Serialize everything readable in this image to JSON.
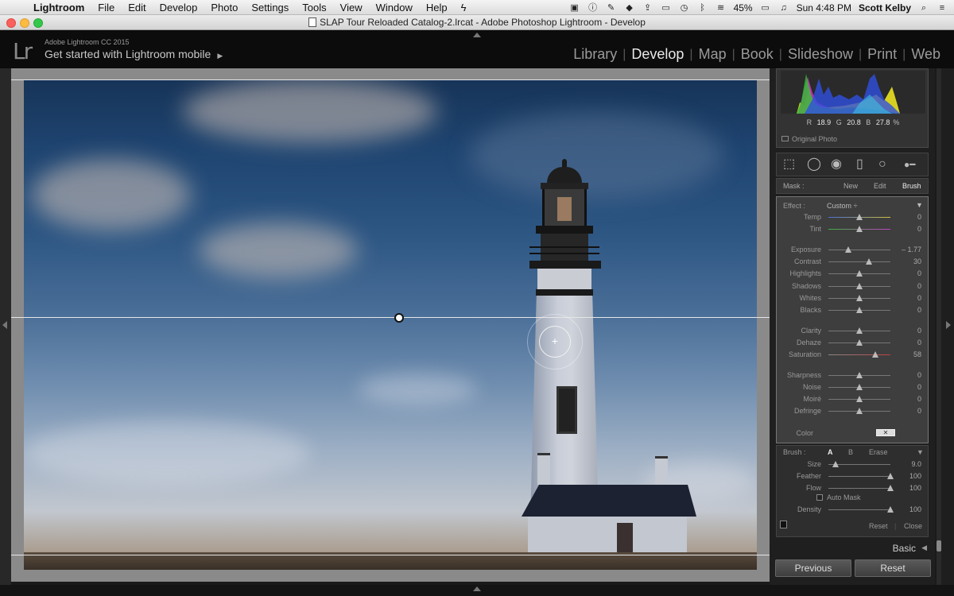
{
  "menubar": {
    "app": "Lightroom",
    "items": [
      "File",
      "Edit",
      "Develop",
      "Photo",
      "Settings",
      "Tools",
      "View",
      "Window",
      "Help"
    ],
    "battery": "45%",
    "clock": "Sun 4:48 PM",
    "user": "Scott Kelby"
  },
  "window": {
    "title": "SLAP Tour Reloaded Catalog-2.lrcat - Adobe Photoshop Lightroom - Develop"
  },
  "identity": {
    "logo": "Lr",
    "app_name": "Adobe Lightroom CC 2015",
    "mobile_prompt": "Get started with Lightroom mobile",
    "mobile_arrow": "▶"
  },
  "modules": [
    "Library",
    "Develop",
    "Map",
    "Book",
    "Slideshow",
    "Print",
    "Web"
  ],
  "active_module": "Develop",
  "histogram": {
    "r_label": "R",
    "r": "18.9",
    "g_label": "G",
    "g": "20.8",
    "b_label": "B",
    "b": "27.8",
    "unit": "%",
    "original_photo": "Original Photo"
  },
  "mask": {
    "label": "Mask :",
    "new": "New",
    "edit": "Edit",
    "brush": "Brush"
  },
  "effect": {
    "label": "Effect :",
    "preset": "Custom",
    "sliders": [
      {
        "name": "Temp",
        "value": "0",
        "pos": 0.5,
        "track": "temp"
      },
      {
        "name": "Tint",
        "value": "0",
        "pos": 0.5,
        "track": "tint"
      },
      {
        "name": "Exposure",
        "value": "– 1.77",
        "pos": 0.32,
        "track": "plain"
      },
      {
        "name": "Contrast",
        "value": "30",
        "pos": 0.65,
        "track": "plain"
      },
      {
        "name": "Highlights",
        "value": "0",
        "pos": 0.5,
        "track": "plain"
      },
      {
        "name": "Shadows",
        "value": "0",
        "pos": 0.5,
        "track": "plain"
      },
      {
        "name": "Whites",
        "value": "0",
        "pos": 0.5,
        "track": "plain"
      },
      {
        "name": "Blacks",
        "value": "0",
        "pos": 0.5,
        "track": "plain"
      },
      {
        "name": "Clarity",
        "value": "0",
        "pos": 0.5,
        "track": "plain"
      },
      {
        "name": "Dehaze",
        "value": "0",
        "pos": 0.5,
        "track": "plain"
      },
      {
        "name": "Saturation",
        "value": "58",
        "pos": 0.76,
        "track": "sat"
      },
      {
        "name": "Sharpness",
        "value": "0",
        "pos": 0.5,
        "track": "plain"
      },
      {
        "name": "Noise",
        "value": "0",
        "pos": 0.5,
        "track": "plain"
      },
      {
        "name": "Moiré",
        "value": "0",
        "pos": 0.5,
        "track": "plain"
      },
      {
        "name": "Defringe",
        "value": "0",
        "pos": 0.5,
        "track": "plain"
      }
    ],
    "color_label": "Color"
  },
  "brush": {
    "label": "Brush :",
    "a": "A",
    "b": "B",
    "erase": "Erase",
    "sliders": [
      {
        "name": "Size",
        "value": "9.0",
        "pos": 0.12
      },
      {
        "name": "Feather",
        "value": "100",
        "pos": 1.0
      },
      {
        "name": "Flow",
        "value": "100",
        "pos": 1.0
      }
    ],
    "auto_mask": "Auto Mask",
    "density_name": "Density",
    "density_value": "100",
    "density_pos": 1.0,
    "reset": "Reset",
    "close": "Close"
  },
  "basic": "Basic",
  "buttons": {
    "previous": "Previous",
    "reset": "Reset"
  },
  "colors": {
    "panel_bg": "#1f1f1f",
    "effect_bg": "#3e3e3e",
    "accent_text": "#e8e8e8"
  }
}
